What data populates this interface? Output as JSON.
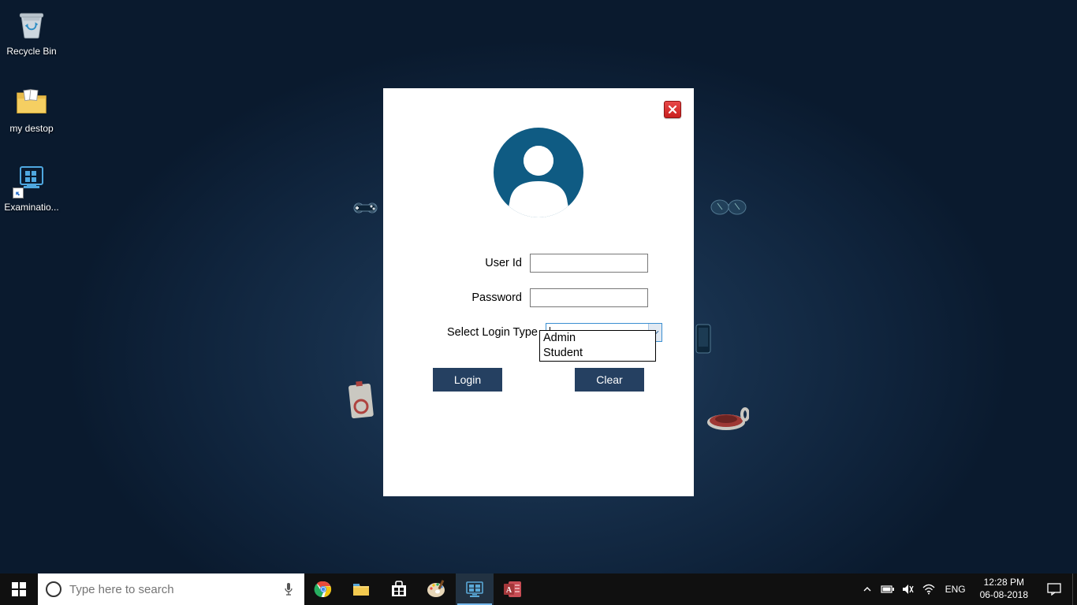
{
  "desktop": {
    "icons": [
      {
        "label": "Recycle Bin"
      },
      {
        "label": "my destop"
      },
      {
        "label": "Examinatio..."
      }
    ]
  },
  "login": {
    "user_id_label": "User Id",
    "password_label": "Password",
    "select_type_label": "Select Login Type",
    "user_id_value": "",
    "password_value": "",
    "combo_value": "",
    "options": [
      "Admin",
      "Student"
    ],
    "login_btn": "Login",
    "clear_btn": "Clear"
  },
  "taskbar": {
    "search_placeholder": "Type here to search",
    "lang": "ENG",
    "time": "12:28 PM",
    "date": "06-08-2018"
  }
}
